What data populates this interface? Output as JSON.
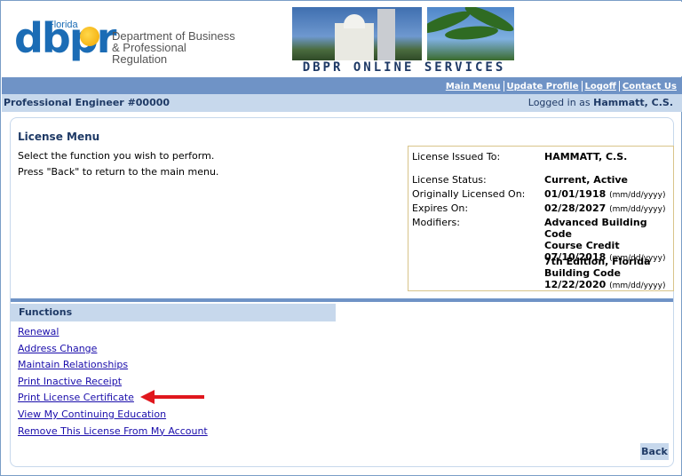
{
  "header": {
    "logo_florida": "Florida",
    "logo_text": "dbpr",
    "dept_line1": "Department of Business",
    "dept_line2": "& Professional Regulation",
    "services_title": "DBPR ONLINE SERVICES"
  },
  "topnav": {
    "items": [
      "Main Menu",
      "Update Profile",
      "Logoff",
      "Contact Us"
    ]
  },
  "subbar": {
    "profession": "Professional Engineer #00000",
    "logged_label": "Logged in as",
    "logged_user": "Hammatt, C.S."
  },
  "license_menu": {
    "title": "License Menu",
    "instruction1": "Select the function you wish to perform.",
    "instruction2": "Press \"Back\" to return to the main menu."
  },
  "license_info": {
    "issued_to_label": "License Issued To:",
    "issued_to_value": "HAMMATT, C.S.",
    "status_label": "License Status:",
    "status_value": "Current, Active",
    "orig_label": "Originally Licensed On:",
    "orig_value": "01/01/1918",
    "expires_label": "Expires On:",
    "expires_value": "02/28/2027",
    "date_format": "(mm/dd/yyyy)",
    "modifiers_label": "Modifiers:",
    "modifier1_line1": "Advanced Building Code",
    "modifier1_line2": "Course Credit",
    "modifier1_date": "07/10/2018",
    "modifier2_line1": "7th Edition, Florida",
    "modifier2_line2": "Building Code",
    "modifier2_date": "12/22/2020"
  },
  "functions": {
    "header": "Functions",
    "items": [
      "Renewal",
      "Address Change",
      "Maintain Relationships",
      "Print Inactive Receipt",
      "Print License Certificate",
      "View My Continuing Education",
      "Remove This License From My Account"
    ]
  },
  "back_label": "Back",
  "colors": {
    "accent_blue": "#6f93c6",
    "light_blue": "#c7d8ec",
    "arrow_red": "#e0171d",
    "link": "#1a0dab"
  }
}
